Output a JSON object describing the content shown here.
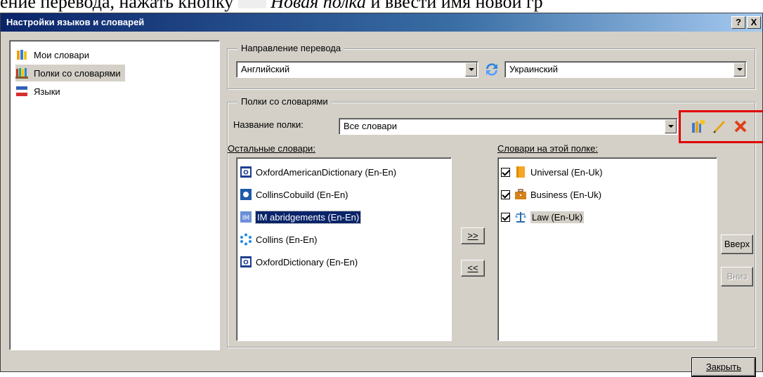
{
  "document_fragment": {
    "text_a": "ение перевода, нажать кнопку",
    "text_b": "Новая полка",
    "text_c": "и ввести имя новой гр"
  },
  "window": {
    "title": "Настройки языков и словарей",
    "help_label": "?",
    "close_label": "X"
  },
  "sidebar": {
    "items": [
      {
        "label": "Мои словари",
        "icon": "books-icon"
      },
      {
        "label": "Полки со словарями",
        "icon": "shelf-icon"
      },
      {
        "label": "Языки",
        "icon": "flag-icon"
      }
    ]
  },
  "direction": {
    "group_title": "Направление перевода",
    "source_value": "Английский",
    "target_value": "Украинский"
  },
  "shelves": {
    "group_title": "Полки со словарями",
    "shelf_name_label": "Название полки:",
    "shelf_name_value": "Все словари",
    "other_label": "Остальные словари:",
    "other_items": [
      {
        "label": "OxfordAmericanDictionary (En-En)",
        "icon": "oxford-icon"
      },
      {
        "label": "CollinsCobuild (En-En)",
        "icon": "collins-cobuild-icon"
      },
      {
        "label": "IM abridgements (En-En)",
        "icon": "im-icon"
      },
      {
        "label": "Collins (En-En)",
        "icon": "collins-icon"
      },
      {
        "label": "OxfordDictionary (En-En)",
        "icon": "oxford-icon"
      }
    ],
    "on_shelf_label": "Словари на этой полке:",
    "on_shelf_items": [
      {
        "label": "Universal (En-Uk)",
        "icon": "universal-icon",
        "checked": true
      },
      {
        "label": "Business (En-Uk)",
        "icon": "briefcase-icon",
        "checked": true
      },
      {
        "label": "Law (En-Uk)",
        "icon": "law-icon",
        "checked": true
      }
    ],
    "add_label": ">>",
    "remove_label": "<<",
    "up_label": "Вверх",
    "down_label": "Вниз"
  },
  "footer": {
    "close_label": "Закрыть"
  },
  "colors": {
    "accent_highlight": "#e00000",
    "title_bar": "#0a246a",
    "dialog_bg": "#d4d0c8"
  }
}
